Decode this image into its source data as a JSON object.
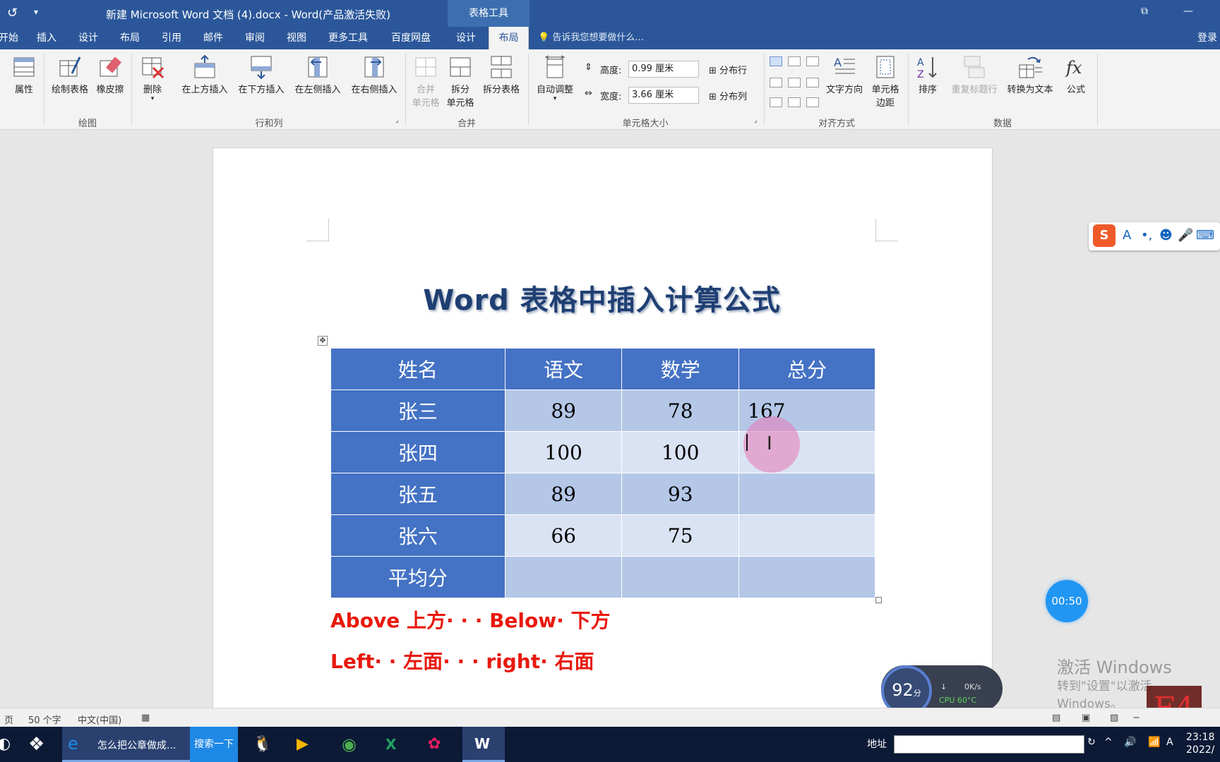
{
  "titlebar": {
    "title": "新建 Microsoft Word 文档 (4).docx - Word(产品激活失败)",
    "context_tools": "表格工具"
  },
  "tabs": [
    {
      "label": "开始",
      "active": false
    },
    {
      "label": "插入",
      "active": false
    },
    {
      "label": "设计",
      "active": false
    },
    {
      "label": "布局",
      "active": false
    },
    {
      "label": "引用",
      "active": false
    },
    {
      "label": "邮件",
      "active": false
    },
    {
      "label": "审阅",
      "active": false
    },
    {
      "label": "视图",
      "active": false
    },
    {
      "label": "更多工具",
      "active": false
    },
    {
      "label": "百度网盘",
      "active": false
    },
    {
      "label": "设计",
      "active": false
    },
    {
      "label": "布局",
      "active": true
    }
  ],
  "tellme": "告诉我您想要做什么...",
  "login": "登录",
  "ribbon": {
    "properties": "属性",
    "draw_table": "绘制表格",
    "eraser": "橡皮擦",
    "delete": "删除",
    "insert_above": "在上方插入",
    "insert_below": "在下方插入",
    "insert_left": "在左侧插入",
    "insert_right": "在右侧插入",
    "merge_cells_1": "合并",
    "merge_cells_2": "单元格",
    "split_cells_1": "拆分",
    "split_cells_2": "单元格",
    "split_table": "拆分表格",
    "autofit": "自动调整",
    "height_label": "高度:",
    "height_value": "0.99 厘米",
    "width_label": "宽度:",
    "width_value": "3.66 厘米",
    "distribute_rows": "分布行",
    "distribute_cols": "分布列",
    "text_direction": "文字方向",
    "cell_margins_1": "单元格",
    "cell_margins_2": "边距",
    "sort": "排序",
    "repeat_header": "重复标题行",
    "convert_text": "转换为文本",
    "formula": "公式",
    "groups": {
      "draw": "绘图",
      "rows_cols": "行和列",
      "merge": "合并",
      "cell_size": "单元格大小",
      "alignment": "对齐方式",
      "data": "数据"
    }
  },
  "document": {
    "title": "Word 表格中插入计算公式",
    "table": {
      "headers": [
        "姓名",
        "语文",
        "数学",
        "总分"
      ],
      "rows": [
        [
          "张三",
          "89",
          "78",
          "167"
        ],
        [
          "张四",
          "100",
          "100",
          ""
        ],
        [
          "张五",
          "89",
          "93",
          ""
        ],
        [
          "张六",
          "66",
          "75",
          ""
        ],
        [
          "平均分",
          "",
          "",
          ""
        ]
      ]
    },
    "caption1": "Above 上方· · · Below· 下方",
    "caption2": "Left· · 左面· · · right· 右面"
  },
  "overlay": {
    "timer": "00:50",
    "watermark_title": "激活 Windows",
    "watermark_sub": "转到\"设置\"以激活 Windows。",
    "monitor_score": "92",
    "monitor_score_unit": "分",
    "monitor_net": "0K/s",
    "monitor_cpu": "CPU 60°C",
    "f4": "F4",
    "ime_letter": "A"
  },
  "statusbar": {
    "page": "页",
    "words": "50 个字",
    "lang": "中文(中国)"
  },
  "taskbar": {
    "ie_label": "怎么把公章做成...",
    "search_btn": "搜索一下",
    "address": "地址",
    "time": "23:18",
    "date": "2022/"
  }
}
